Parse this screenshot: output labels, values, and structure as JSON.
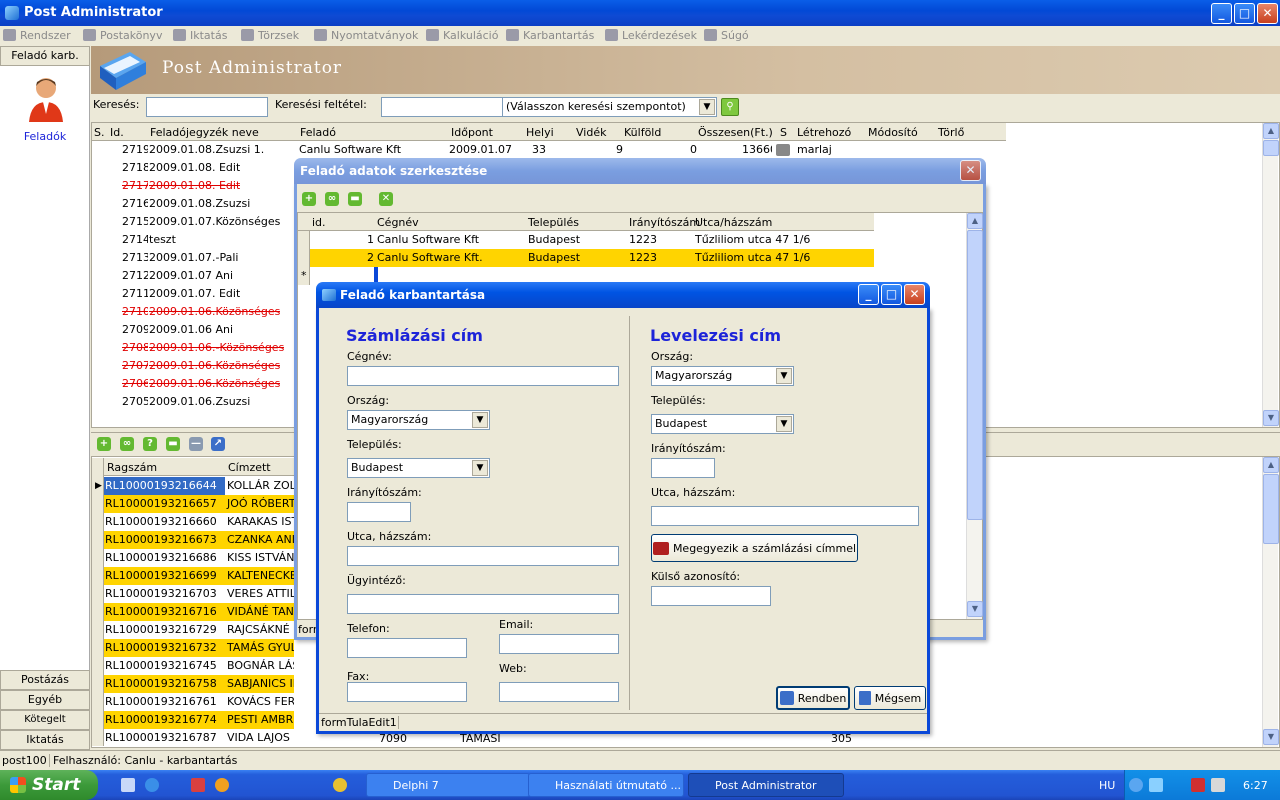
{
  "window": {
    "title": "Post Administrator"
  },
  "menu": [
    "Rendszer",
    "Postakönyv",
    "Iktatás",
    "Törzsek",
    "Nyomtatványok",
    "Kalkuláció",
    "Karbantartás",
    "Lekérdezések",
    "Súgó"
  ],
  "left": {
    "header": "Feladó karb.",
    "item": "Feladók",
    "bottom": [
      "Postázás",
      "Egyéb",
      "Kötegelt postázás",
      "Iktatás"
    ]
  },
  "banner": {
    "title": "Post Administrator"
  },
  "search": {
    "label": "Keresés:",
    "criteria_label": "Keresési feltétel:",
    "combo_value": "(Válasszon keresési szempontot)"
  },
  "top_grid": {
    "headers": [
      "S.",
      "Id.",
      "Feladójegyzék neve",
      "Feladó",
      "Időpont",
      "Helyi",
      "Vidék",
      "Külföld",
      "Összesen(Ft.)",
      "S",
      "Létrehozó",
      "Módosító",
      "Törlő"
    ],
    "first_row": {
      "id": "2719",
      "name": "2009.01.08.Zsuzsi 1.",
      "sender": "Canlu Software Kft",
      "date": "2009.01.07",
      "local": "33",
      "domestic": "9",
      "abroad": "0",
      "total": "13660",
      "creator": "marlaj"
    },
    "rows": [
      {
        "id": "2718",
        "name": "2009.01.08. Edit",
        "deleted": false
      },
      {
        "id": "2717",
        "name": "2009.01.08. Edit",
        "deleted": true
      },
      {
        "id": "2716",
        "name": "2009.01.08.Zsuzsi",
        "deleted": false
      },
      {
        "id": "2715",
        "name": "2009.01.07.Közönséges",
        "deleted": false
      },
      {
        "id": "2714",
        "name": "teszt",
        "deleted": false
      },
      {
        "id": "2713",
        "name": "2009.01.07.-Pali",
        "deleted": false
      },
      {
        "id": "2712",
        "name": "2009.01.07 Ani",
        "deleted": false
      },
      {
        "id": "2711",
        "name": "2009.01.07. Edit",
        "deleted": false
      },
      {
        "id": "2710",
        "name": "2009.01.06.Közönséges",
        "deleted": true
      },
      {
        "id": "2709",
        "name": "2009.01.06 Ani",
        "deleted": false
      },
      {
        "id": "2708",
        "name": "2009.01.06.-Közönséges",
        "deleted": true
      },
      {
        "id": "2707",
        "name": "2009.01.06.Közönséges",
        "deleted": true
      },
      {
        "id": "2706",
        "name": "2009.01.06.Közönséges",
        "deleted": true
      },
      {
        "id": "2705",
        "name": "2009.01.06.Zsuzsi",
        "deleted": false
      }
    ]
  },
  "bottom_grid": {
    "headers": [
      "Ragszám",
      "Címzett"
    ],
    "rows": [
      {
        "code": "RL10000193216644",
        "name": "KOLLÁR ZOLT",
        "hl": "sel"
      },
      {
        "code": "RL10000193216657",
        "name": "JOÓ RÓBERT",
        "hl": "y"
      },
      {
        "code": "RL10000193216660",
        "name": "KARAKAS ISTV",
        "hl": ""
      },
      {
        "code": "RL10000193216673",
        "name": "CZANKA ANIT",
        "hl": "y"
      },
      {
        "code": "RL10000193216686",
        "name": "KISS ISTVÁN",
        "hl": ""
      },
      {
        "code": "RL10000193216699",
        "name": "KALTENECKER",
        "hl": "y"
      },
      {
        "code": "RL10000193216703",
        "name": "VERES ATTILÁ",
        "hl": ""
      },
      {
        "code": "RL10000193216716",
        "name": "VIDÁNÉ TANK",
        "hl": "y"
      },
      {
        "code": "RL10000193216729",
        "name": "RAJCSÁKNÉ P",
        "hl": ""
      },
      {
        "code": "RL10000193216732",
        "name": "TAMÁS GYULÁNÉ",
        "hl": "y"
      },
      {
        "code": "RL10000193216745",
        "name": "BOGNÁR LÁSZLÓN",
        "hl": ""
      },
      {
        "code": "RL10000193216758",
        "name": "SABJANICS IMRE",
        "hl": "y"
      },
      {
        "code": "RL10000193216761",
        "name": "KOVÁCS FERENC",
        "hl": ""
      },
      {
        "code": "RL10000193216774",
        "name": "PESTI AMBRUS",
        "hl": "y"
      },
      {
        "code": "RL10000193216787",
        "name": "VIDA LAJOS",
        "hl": ""
      }
    ],
    "last_row_extra": {
      "zip": "7090",
      "city": "TAMÁSI",
      "amount": "305"
    }
  },
  "dialog1": {
    "title": "Feladó adatok szerkesztése",
    "headers": [
      "id.",
      "Cégnév",
      "Település",
      "Irányítószám",
      "Utca/házszám"
    ],
    "rows": [
      {
        "id": "1",
        "company": "Canlu Software Kft",
        "city": "Budapest",
        "zip": "1223",
        "street": "Tűzliliom utca 47 1/6"
      },
      {
        "id": "2",
        "company": "Canlu Software Kft.",
        "city": "Budapest",
        "zip": "1223",
        "street": "Tűzliliom utca 47 1/6"
      }
    ],
    "new_row_marker": "*",
    "status": "form"
  },
  "dialog2": {
    "title": "Feladó karbantartása",
    "billing": {
      "section": "Számlázási cím",
      "company_label": "Cégnév:",
      "country_label": "Ország:",
      "country": "Magyarország",
      "city_label": "Település:",
      "city": "Budapest",
      "zip_label": "Irányítószám:",
      "street_label": "Utca, házszám:",
      "contact_label": "Ügyintéző:",
      "phone_label": "Telefon:",
      "email_label": "Email:",
      "fax_label": "Fax:",
      "web_label": "Web:"
    },
    "postal": {
      "section": "Levelezési cím",
      "country_label": "Ország:",
      "country": "Magyarország",
      "city_label": "Település:",
      "city": "Budapest",
      "zip_label": "Irányítószám:",
      "street_label": "Utca, házszám:",
      "same_button": "Megegyezik a számlázási címmel",
      "external_label": "Külső azonosító:"
    },
    "ok_button": "Rendben",
    "cancel_button": "Mégsem",
    "status": "formTulaEdit1"
  },
  "statusbar": {
    "left": "post100",
    "user": "Felhasználó: Canlu - karbantartás"
  },
  "taskbar": {
    "start": "Start",
    "tasks": [
      "Delphi 7",
      "Használati útmutató ...",
      "Post Administrator"
    ],
    "lang": "HU",
    "time": "6:27"
  }
}
